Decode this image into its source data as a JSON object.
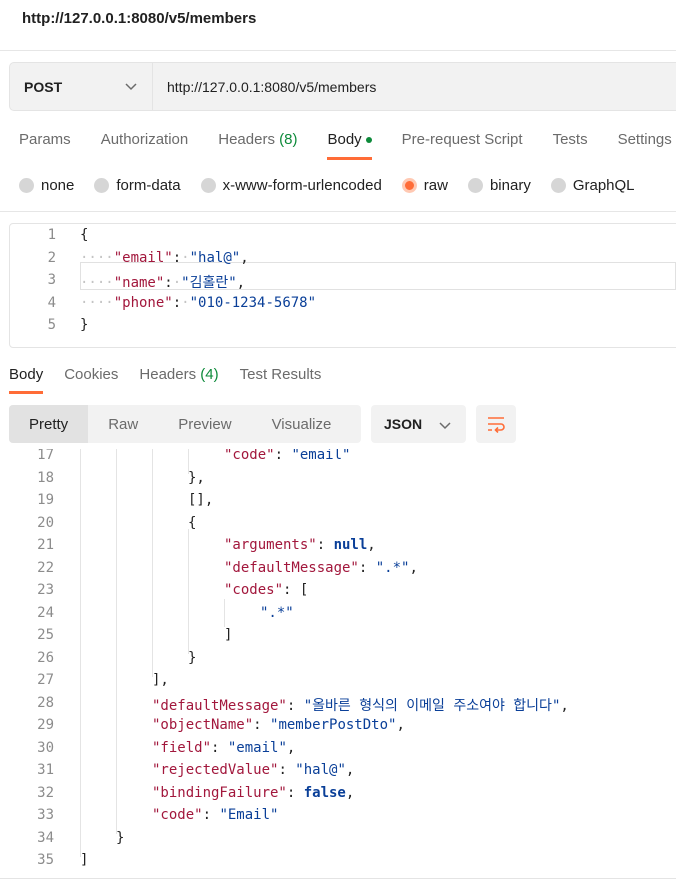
{
  "window_title": "http://127.0.0.1:8080/v5/members",
  "request": {
    "method": "POST",
    "url": "http://127.0.0.1:8080/v5/members"
  },
  "request_tabs": {
    "params": "Params",
    "authorization": "Authorization",
    "headers": "Headers",
    "headers_count": "(8)",
    "body": "Body",
    "pre_request": "Pre-request Script",
    "tests": "Tests",
    "settings": "Settings"
  },
  "body_types": [
    "none",
    "form-data",
    "x-www-form-urlencoded",
    "raw",
    "binary",
    "GraphQL"
  ],
  "request_body": {
    "lines": [
      "1",
      "2",
      "3",
      "4",
      "5"
    ],
    "open": "{",
    "close": "}",
    "email_key": "\"email\"",
    "email_val": "\"hal@\"",
    "name_key": "\"name\"",
    "name_val": "\"김홀란\"",
    "phone_key": "\"phone\"",
    "phone_val": "\"010-1234-5678\""
  },
  "response_tabs": {
    "body": "Body",
    "cookies": "Cookies",
    "headers": "Headers",
    "headers_count": "(4)",
    "test_results": "Test Results"
  },
  "view_modes": [
    "Pretty",
    "Raw",
    "Preview",
    "Visualize"
  ],
  "format": "JSON",
  "response_body": {
    "line_numbers": [
      "17",
      "18",
      "19",
      "20",
      "21",
      "22",
      "23",
      "24",
      "25",
      "26",
      "27",
      "28",
      "29",
      "30",
      "31",
      "32",
      "33",
      "34",
      "35"
    ],
    "code_key": "\"code\"",
    "code_val": "\"email\"",
    "close_obj_comma": "},",
    "empty_array": "[],",
    "open_obj": "{",
    "arguments_key": "\"arguments\"",
    "null_val": "null",
    "default_message_key": "\"defaultMessage\"",
    "regex_val": "\".*\"",
    "codes_key": "\"codes\"",
    "open_array": "[",
    "close_array": "]",
    "close_obj": "}",
    "close_array_comma": "],",
    "default_message_val": "\"올바른 형식의 이메일 주소여야 합니다\"",
    "object_name_key": "\"objectName\"",
    "object_name_val": "\"memberPostDto\"",
    "field_key": "\"field\"",
    "field_val": "\"email\"",
    "rejected_value_key": "\"rejectedValue\"",
    "rejected_value_val": "\"hal@\"",
    "binding_failure_key": "\"bindingFailure\"",
    "false_val": "false",
    "code_val2": "\"Email\"",
    "end_array": "]"
  },
  "colors": {
    "accent": "#ff6c37",
    "json_key": "#a2173c",
    "json_string": "#0a3f98",
    "success": "#0d8a3a"
  }
}
